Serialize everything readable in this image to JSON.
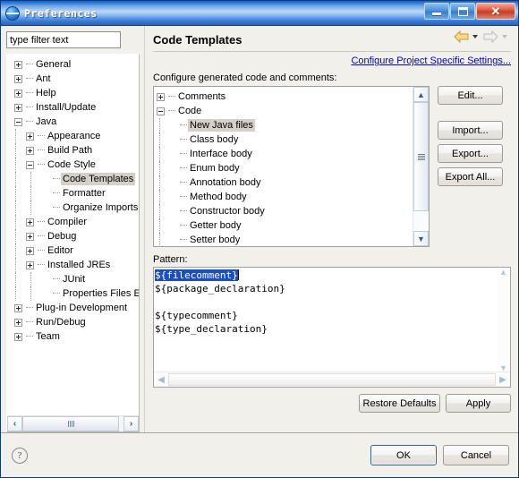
{
  "window": {
    "title": "Preferences",
    "icon": "eclipse-globe-icon",
    "minimize_label": "Minimize",
    "maximize_label": "Maximize",
    "close_label": "Close"
  },
  "sidebar": {
    "filter": {
      "value": "type filter text",
      "placeholder": "type filter text"
    },
    "items": [
      {
        "label": "General",
        "level": 0,
        "state": "collapsed"
      },
      {
        "label": "Ant",
        "level": 0,
        "state": "collapsed"
      },
      {
        "label": "Help",
        "level": 0,
        "state": "collapsed"
      },
      {
        "label": "Install/Update",
        "level": 0,
        "state": "collapsed"
      },
      {
        "label": "Java",
        "level": 0,
        "state": "expanded"
      },
      {
        "label": "Appearance",
        "level": 1,
        "state": "collapsed"
      },
      {
        "label": "Build Path",
        "level": 1,
        "state": "collapsed"
      },
      {
        "label": "Code Style",
        "level": 1,
        "state": "expanded"
      },
      {
        "label": "Code Templates",
        "level": 2,
        "state": "leaf",
        "selected": true
      },
      {
        "label": "Formatter",
        "level": 2,
        "state": "leaf"
      },
      {
        "label": "Organize Imports",
        "level": 2,
        "state": "leaf"
      },
      {
        "label": "Compiler",
        "level": 1,
        "state": "collapsed"
      },
      {
        "label": "Debug",
        "level": 1,
        "state": "collapsed"
      },
      {
        "label": "Editor",
        "level": 1,
        "state": "collapsed"
      },
      {
        "label": "Installed JREs",
        "level": 1,
        "state": "collapsed"
      },
      {
        "label": "JUnit",
        "level": 2,
        "state": "leaf"
      },
      {
        "label": "Properties Files Edito",
        "level": 2,
        "state": "leaf"
      },
      {
        "label": "Plug-in Development",
        "level": 0,
        "state": "collapsed"
      },
      {
        "label": "Run/Debug",
        "level": 0,
        "state": "collapsed"
      },
      {
        "label": "Team",
        "level": 0,
        "state": "collapsed"
      }
    ],
    "scrollbar": {
      "left_arrow": "‹",
      "right_arrow": "›"
    }
  },
  "main": {
    "page_title": "Code Templates",
    "project_settings_link": "Configure Project Specific Settings...",
    "section_label": "Configure generated code and comments:",
    "nav": {
      "back_label": "Back",
      "back_menu_label": "Back history",
      "forward_label": "Forward",
      "forward_menu_label": "Forward history"
    },
    "template_tree": [
      {
        "label": "Comments",
        "level": 0,
        "state": "collapsed"
      },
      {
        "label": "Code",
        "level": 0,
        "state": "expanded"
      },
      {
        "label": "New Java files",
        "level": 1,
        "state": "leaf",
        "selected": true
      },
      {
        "label": "Class body",
        "level": 1,
        "state": "leaf"
      },
      {
        "label": "Interface body",
        "level": 1,
        "state": "leaf"
      },
      {
        "label": "Enum body",
        "level": 1,
        "state": "leaf"
      },
      {
        "label": "Annotation body",
        "level": 1,
        "state": "leaf"
      },
      {
        "label": "Method body",
        "level": 1,
        "state": "leaf"
      },
      {
        "label": "Constructor body",
        "level": 1,
        "state": "leaf"
      },
      {
        "label": "Getter body",
        "level": 1,
        "state": "leaf"
      },
      {
        "label": "Setter body",
        "level": 1,
        "state": "leaf"
      }
    ],
    "side_buttons": [
      {
        "label": "Edit...",
        "name": "edit-button"
      },
      {
        "label": "Import...",
        "name": "import-button"
      },
      {
        "label": "Export...",
        "name": "export-button"
      },
      {
        "label": "Export All...",
        "name": "export-all-button"
      }
    ],
    "pattern": {
      "label": "Pattern:",
      "selected_text": "${filecomment}",
      "lines": [
        "${package_declaration}",
        "",
        "${typecomment}",
        "${type_declaration}"
      ],
      "selection_color": "#1a4fc4"
    },
    "restore_defaults_label": "Restore Defaults",
    "apply_label": "Apply"
  },
  "footer": {
    "help_icon": "question-mark-icon",
    "ok_label": "OK",
    "cancel_label": "Cancel"
  }
}
